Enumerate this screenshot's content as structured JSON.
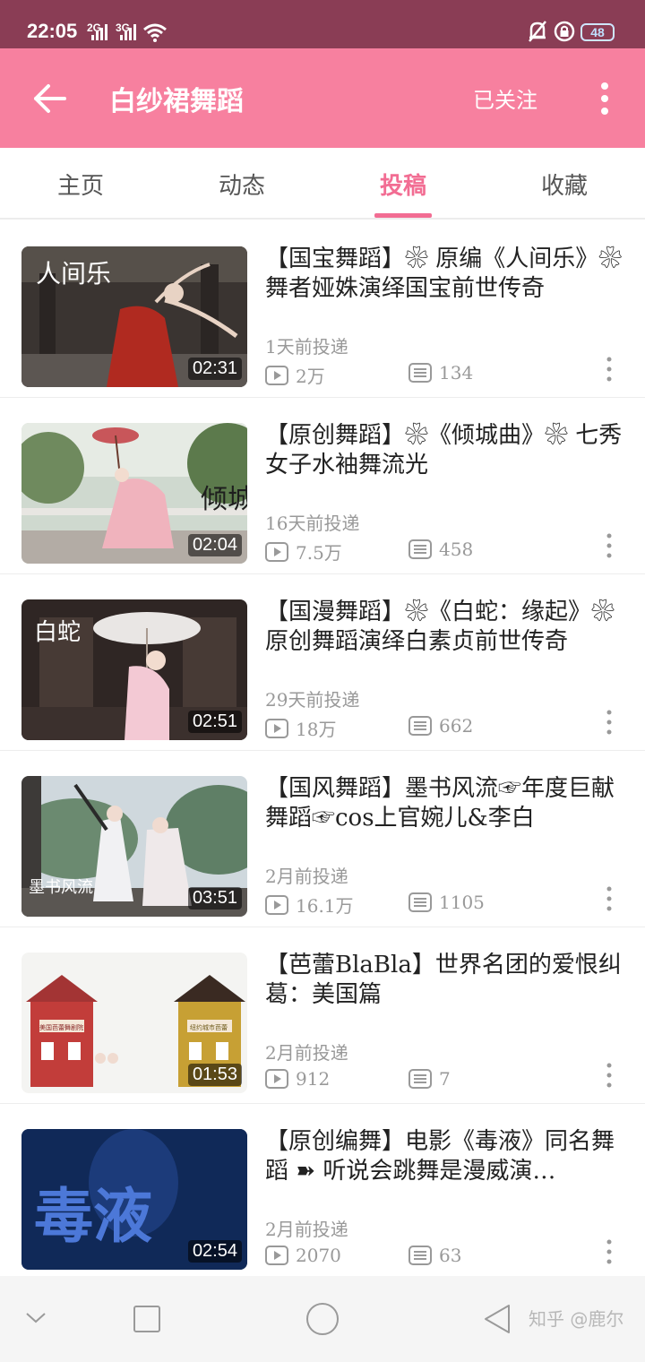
{
  "status_bar": {
    "time": "22:05",
    "net1": "2G",
    "net2": "3G",
    "battery": "48"
  },
  "app_bar": {
    "title": "白纱裙舞蹈",
    "follow_label": "已关注",
    "back_icon": "back-arrow-icon",
    "more_icon": "more-vertical-icon"
  },
  "tabs": [
    {
      "label": "主页"
    },
    {
      "label": "动态"
    },
    {
      "label": "投稿",
      "active": true
    },
    {
      "label": "收藏"
    }
  ],
  "videos": [
    {
      "title": "【国宝舞蹈】❀ 原编《人间乐》❀ 舞者娅姝演绎国宝前世传奇",
      "time": "1天前投递",
      "views": "2万",
      "comments": "134",
      "duration": "02:31"
    },
    {
      "title": "【原创舞蹈】❀《倾城曲》❀ 七秀女子水袖舞流光",
      "time": "16天前投递",
      "views": "7.5万",
      "comments": "458",
      "duration": "02:04"
    },
    {
      "title": "【国漫舞蹈】❀《白蛇：缘起》❀ 原创舞蹈演绎白素贞前世传奇",
      "time": "29天前投递",
      "views": "18万",
      "comments": "662",
      "duration": "02:51"
    },
    {
      "title": "【国风舞蹈】墨书风流☞年度巨献舞蹈☞cos上官婉儿&李白",
      "time": "2月前投递",
      "views": "16.1万",
      "comments": "1105",
      "duration": "03:51"
    },
    {
      "title": "【芭蕾BlaBla】世界名团的爱恨纠葛：美国篇",
      "time": "2月前投递",
      "views": "912",
      "comments": "7",
      "duration": "01:53"
    },
    {
      "title": "【原创编舞】电影《毒液》同名舞蹈 ➽ 听说会跳舞是漫威演…",
      "time": "2月前投递",
      "views": "2070",
      "comments": "63",
      "duration": "02:54"
    }
  ],
  "thumb_text": {
    "t1": "人间乐",
    "t2": "倾城",
    "t3": "白蛇",
    "t4": "墨书风流",
    "t5a": "美国芭蕾舞剧院",
    "t5b": "纽约城市芭蕾",
    "t6": "毒液"
  },
  "nav_bar": {
    "watermark": "知乎 @鹿尔"
  },
  "colors": {
    "status_bar": "#8a3d55",
    "app_bar": "#f7809f",
    "accent": "#f26d93"
  }
}
